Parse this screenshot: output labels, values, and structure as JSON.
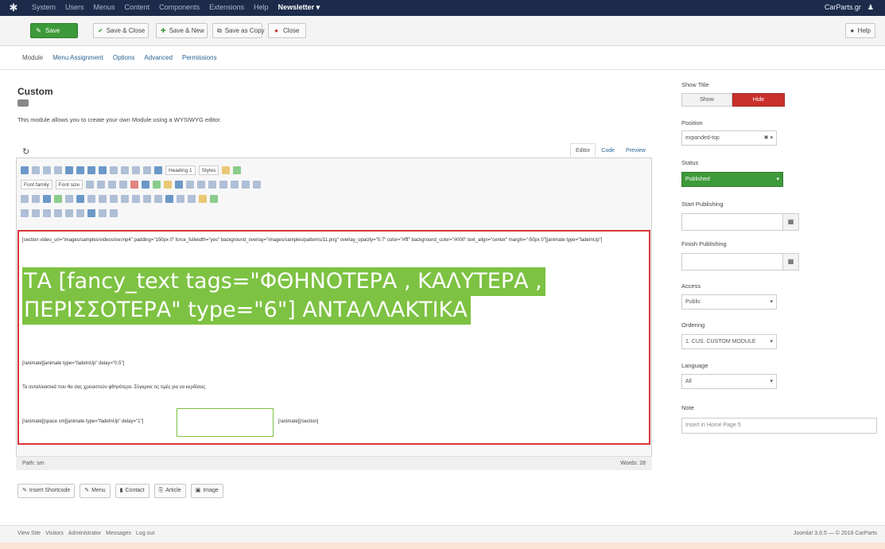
{
  "topbar": {
    "menu": [
      "System",
      "Users",
      "Menus",
      "Content",
      "Components",
      "Extensions",
      "Help"
    ],
    "active_menu": "Newsletter ▾",
    "user": "CarParts.gr",
    "user_icon": "user-icon"
  },
  "toolbar": {
    "save": "Save",
    "save_close": "Save & Close",
    "save_new": "Save & New",
    "save_copy": "Save as Copy",
    "close": "Close",
    "help": "Help"
  },
  "tabs": [
    "Module",
    "Menu Assignment",
    "Options",
    "Advanced",
    "Permissions"
  ],
  "main": {
    "title": "Custom",
    "badge": "Site",
    "description": "This module allows you to create your own Module using a WYSIWYG editor."
  },
  "editor": {
    "tabs": [
      "Editor",
      "Code",
      "Preview"
    ],
    "toolbar": {
      "heading": "Heading 1",
      "font": "Styles",
      "font_family": "Font family",
      "font_size": "Font size"
    },
    "code_line1": "[section video_url=\"images/samples/videos/sw.mp4\" padding=\"150px 0\" force_fullwidth=\"yes\" background_overlay=\"images/samples/patterns/11.png\" overlay_opacity=\"0.7\" color=\"#fff\" background_color=\"#000\" text_align=\"center\" margin=\"-50px 0\"][animate type=\"fadeInUp\"]",
    "highlight_line1": "ΤΑ [fancy_text tags=\"ΦΘΗΝΟΤΕΡΑ , ΚΑΛΥΤΕΡΑ ,",
    "highlight_line2": "ΠΕΡΙΣΣΟΤΕΡΑ\" type=\"6\"] ΑΝΤΑΛΛΑΚΤΙΚΑ",
    "code_line2": "[/animate][animate type=\"fadeInUp\" delay=\"0.5\"]",
    "paragraph": "Τα ανταλλακτικά που θα σας χρειαστούν φθηνότερα. Σύγκρινε τις τιμές για να κερδίσεις.",
    "code_line3a": "[/animate][space sm][animate type=\"fadeInUp\" delay=\"1\"]",
    "code_line3b": "[/animate][/section]",
    "status_path": "Path: ",
    "status_path_value": "sm",
    "words": "Words: 28"
  },
  "ext_buttons": [
    "Insert Shortcode",
    "Menu",
    "Contact",
    "Article",
    "Image"
  ],
  "sidebar": {
    "show_title_label": "Show Title",
    "show": "Show",
    "hide": "Hide",
    "position_label": "Position",
    "position_value": "expanded-top",
    "status_label": "Status",
    "status_value": "Published",
    "start_publishing_label": "Start Publishing",
    "finish_publishing_label": "Finish Publishing",
    "access_label": "Access",
    "access_value": "Public",
    "ordering_label": "Ordering",
    "ordering_value": "1. CUS. CUSTOM MODULE",
    "language_label": "Language",
    "language_value": "All",
    "note_label": "Note",
    "note_placeholder": "Insert in Home Page 5"
  },
  "footer": {
    "items": [
      "View Site",
      "Visitors",
      "Administrator",
      "Messages",
      "Log out"
    ],
    "version": "Joomla! 3.6.5 — © 2018 CarParts"
  }
}
